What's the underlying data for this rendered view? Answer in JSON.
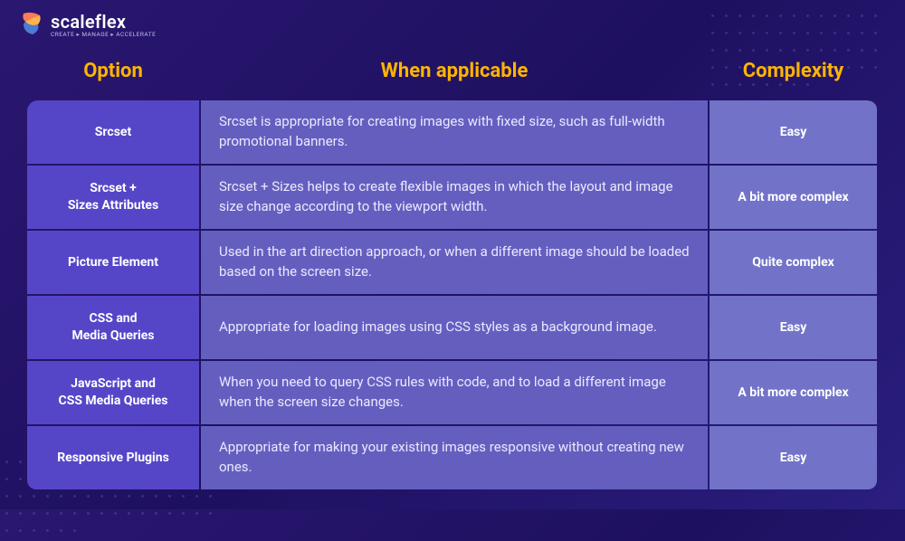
{
  "brand": {
    "name": "scaleflex",
    "tagline": "CREATE ▸ MANAGE ▸ ACCELERATE"
  },
  "table": {
    "headers": {
      "option": "Option",
      "when": "When applicable",
      "complexity": "Complexity"
    },
    "rows": [
      {
        "option": "Srcset",
        "when": "Srcset is appropriate for creating images with fixed size, such as full-width promotional banners.",
        "complexity": "Easy"
      },
      {
        "option": "Srcset +\nSizes Attributes",
        "when": "Srcset + Sizes helps to create flexible images in which the layout and image size change according to the viewport width.",
        "complexity": "A bit more complex"
      },
      {
        "option": "Picture Element",
        "when": "Used in the art direction approach, or when a different image should be loaded based on the screen size.",
        "complexity": "Quite complex"
      },
      {
        "option": "CSS and\nMedia Queries",
        "when": "Appropriate for loading images using CSS styles as a background image.",
        "complexity": "Easy"
      },
      {
        "option": "JavaScript and\nCSS Media Queries",
        "when": "When you need to query CSS rules with code, and to load a different image when the screen size changes.",
        "complexity": "A bit more complex"
      },
      {
        "option": "Responsive Plugins",
        "when": "Appropriate for making your existing images responsive without creating new ones.",
        "complexity": "Easy"
      }
    ]
  }
}
